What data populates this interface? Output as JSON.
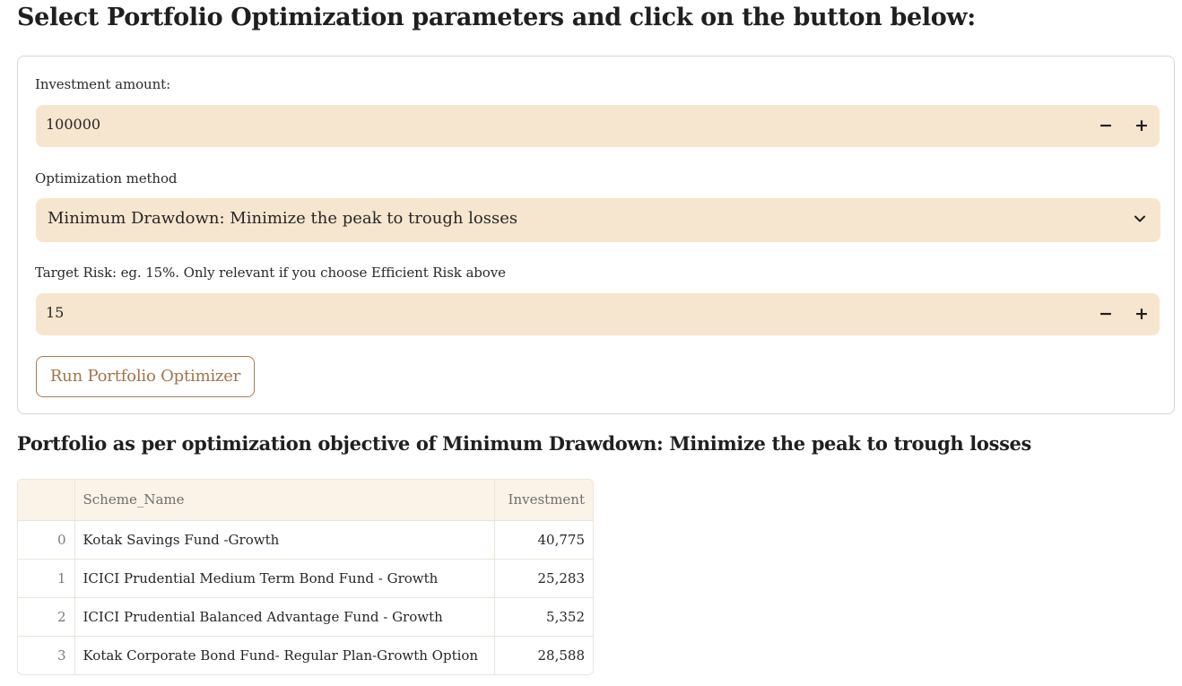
{
  "page": {
    "title": "Select Portfolio Optimization parameters and click on the button below:"
  },
  "form": {
    "investment": {
      "label": "Investment amount:",
      "value": "100000",
      "minus": "−",
      "plus": "+"
    },
    "method": {
      "label": "Optimization method",
      "selected": "Minimum Drawdown: Minimize the peak to trough losses",
      "icon": "chevron-down-icon"
    },
    "target_risk": {
      "label": "Target Risk: eg. 15%. Only relevant if you choose Efficient Risk above",
      "value": "15",
      "minus": "−",
      "plus": "+"
    },
    "run_button": "Run Portfolio Optimizer"
  },
  "result": {
    "title": "Portfolio as per optimization objective of Minimum Drawdown: Minimize the peak to trough losses",
    "table": {
      "headers": [
        "",
        "Scheme_Name",
        "Investment"
      ],
      "rows": [
        {
          "index": "0",
          "scheme": "Kotak Savings Fund -Growth",
          "investment": "40,775"
        },
        {
          "index": "1",
          "scheme": "ICICI Prudential Medium Term Bond Fund - Growth",
          "investment": "25,283"
        },
        {
          "index": "2",
          "scheme": "ICICI Prudential Balanced Advantage Fund - Growth",
          "investment": "5,352"
        },
        {
          "index": "3",
          "scheme": "Kotak Corporate Bond Fund- Regular Plan-Growth Option",
          "investment": "28,588"
        }
      ]
    }
  },
  "colors": {
    "input_bg": "#f7e6cf",
    "accent": "#a2744a",
    "table_header_bg": "#fcf3e8"
  }
}
